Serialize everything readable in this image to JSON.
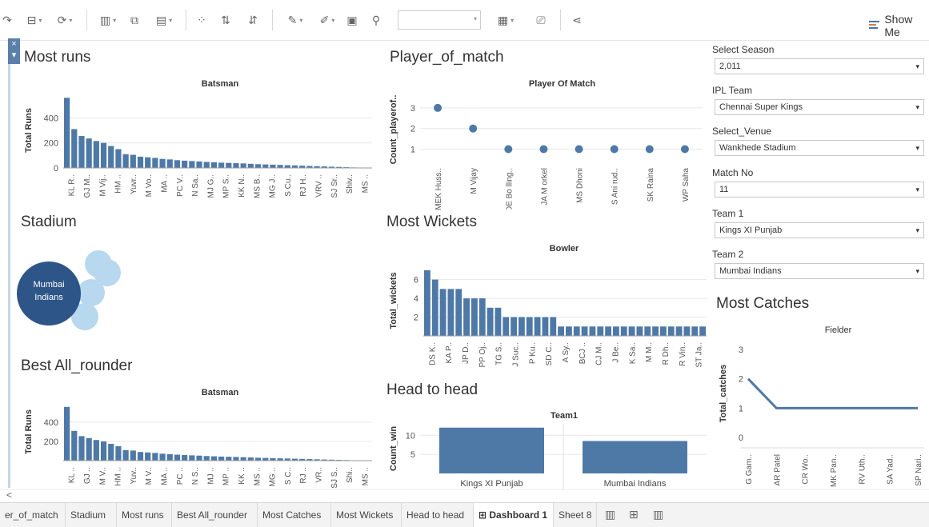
{
  "toolbar": {
    "show_me_label": "Show Me",
    "icons": [
      "redo-icon",
      "data-source-icon",
      "refresh-icon",
      "new-worksheet-icon",
      "duplicate-sheet-icon",
      "clear-sheet-icon",
      "group-icon",
      "sort-ascending-icon",
      "sort-descending-icon",
      "highlight-icon",
      "annotate-icon",
      "text-label-icon",
      "pin-icon",
      "fit-icon",
      "presentation-icon",
      "share-icon"
    ]
  },
  "dashboard": {
    "most_runs": {
      "title": "Most runs",
      "chart_data": {
        "type": "bar",
        "title": "Batsman",
        "ylabel": "Total Runs",
        "ylim": [
          0,
          600
        ],
        "yticks": [
          0,
          200,
          400
        ],
        "categories": [
          "KL R..",
          "GJ M..",
          "M Vij..",
          "HM ..",
          "Yuvr..",
          "M Vo..",
          "MA ..",
          "PC V..",
          "N Sa..",
          "MJ G..",
          "MP S..",
          "KK N..",
          "MS B..",
          "MG J..",
          "S Cu..",
          "RJ H..",
          "VRV ..",
          "SJ Sr..",
          "Shiv..",
          "MS .."
        ],
        "values": [
          560,
          310,
          255,
          235,
          215,
          200,
          175,
          150,
          110,
          105,
          90,
          85,
          80,
          72,
          68,
          62,
          58,
          55,
          52,
          48,
          45,
          42,
          40,
          38,
          36,
          33,
          30,
          28,
          26,
          24,
          22,
          20,
          18,
          16,
          14,
          12,
          10,
          8,
          6,
          4,
          3,
          2
        ]
      }
    },
    "player_of_match": {
      "title": "Player_of_match",
      "chart_data": {
        "type": "scatter",
        "title": "Player Of Match",
        "ylabel": "Count_playerof..",
        "ylim": [
          0.4,
          3.5
        ],
        "yticks": [
          1,
          2,
          3
        ],
        "categories": [
          "MEK Huss..",
          "M Vijay",
          "DE Bo lling..",
          "JA M orkel",
          "MS Dhoni",
          "S Ani rud..",
          "SK Raina",
          "WP Saha"
        ],
        "values": [
          3,
          2,
          1,
          1,
          1,
          1,
          1,
          1
        ]
      }
    },
    "stadium": {
      "title": "Stadium",
      "main_label": "Mumbai Indians",
      "main_color": "#2d5587",
      "other_color": "#b7d8ee"
    },
    "most_wickets": {
      "title": "Most Wickets",
      "chart_data": {
        "type": "bar",
        "title": "Bowler",
        "ylabel": "Total_wickets",
        "ylim": [
          0,
          7.5
        ],
        "yticks": [
          2,
          4,
          6
        ],
        "categories": [
          "DS K..",
          "KA P..",
          "JP D..",
          "PP Oj..",
          "TG S..",
          "J Suc..",
          "P Ku..",
          "SD C..",
          "A Sy..",
          "BCJ ..",
          "CJ M..",
          "J Be..",
          "K Sa..",
          "M M..",
          "R Dh..",
          "R Vin..",
          "ST Ja.."
        ],
        "values": [
          7,
          6,
          5,
          5,
          5,
          4,
          4,
          4,
          3,
          3,
          2,
          2,
          2,
          2,
          2,
          2,
          2,
          1,
          1,
          1,
          1,
          1,
          1,
          1,
          1,
          1,
          1,
          1,
          1,
          1,
          1,
          1,
          1,
          1,
          1,
          1
        ]
      }
    },
    "best_all_rounder": {
      "title": "Best All_rounder",
      "chart_data": {
        "type": "bar",
        "title": "Batsman",
        "ylabel": "Total Runs",
        "ylim": [
          0,
          600
        ],
        "yticks": [
          200,
          400
        ],
        "categories": [
          "KL ..",
          "GJ ..",
          "M V..",
          "HM ..",
          "Yuv..",
          "M V..",
          "MA ..",
          "PC ..",
          "N S..",
          "MJ ..",
          "MP ..",
          "KK ..",
          "MS ..",
          "MG ..",
          "S C..",
          "RJ ..",
          "VR..",
          "SJ S..",
          "Shi..",
          "MS .."
        ],
        "values": [
          560,
          310,
          255,
          235,
          215,
          200,
          175,
          150,
          110,
          105,
          90,
          85,
          80,
          72,
          68,
          62,
          58,
          55,
          52,
          48,
          45,
          42,
          40,
          38,
          36,
          33,
          30,
          28,
          26,
          24,
          22,
          20,
          18,
          16,
          14,
          12,
          10,
          8,
          6,
          4,
          3,
          2
        ]
      }
    },
    "head_to_head": {
      "title": "Head to head",
      "chart_data": {
        "type": "bar",
        "title": "Team1",
        "ylabel": "Count_win",
        "ylim": [
          0,
          13
        ],
        "yticks": [
          5,
          10
        ],
        "categories": [
          "Kings XI Punjab",
          "Mumbai Indians"
        ],
        "values": [
          12,
          8.5
        ]
      }
    },
    "most_catches": {
      "title": "Most Catches",
      "chart_data": {
        "type": "line",
        "title": "Fielder",
        "ylabel": "Total_catches",
        "ylim": [
          -0.3,
          3.3
        ],
        "yticks": [
          0,
          1,
          2,
          3
        ],
        "categories": [
          "G Gam..",
          "AR Patel",
          "CR Wo..",
          "MK Pan..",
          "RV Uth..",
          "SA Yad..",
          "SP Nari.."
        ],
        "values": [
          2,
          1,
          1,
          1,
          1,
          1,
          1
        ]
      }
    }
  },
  "filters": [
    {
      "label": "Select Season",
      "value": "2,011"
    },
    {
      "label": "IPL Team",
      "value": "Chennai Super Kings"
    },
    {
      "label": "Select_Venue",
      "value": "Wankhede Stadium"
    },
    {
      "label": "Match No",
      "value": "11"
    },
    {
      "label": "Team 1",
      "value": "Kings XI Punjab"
    },
    {
      "label": "Team 2",
      "value": "Mumbai Indians"
    }
  ],
  "scroll": {
    "left_arrow": "<"
  },
  "tabs": [
    {
      "label": "er_of_match",
      "active": false
    },
    {
      "label": "Stadium",
      "active": false
    },
    {
      "label": "Most runs",
      "active": false
    },
    {
      "label": "Best All_rounder",
      "active": false
    },
    {
      "label": "Most Catches",
      "active": false
    },
    {
      "label": "Most Wickets",
      "active": false
    },
    {
      "label": "Head to head",
      "active": false
    },
    {
      "label": "Dashboard 1",
      "active": true
    },
    {
      "label": "Sheet 8",
      "active": false
    }
  ],
  "close_glyph": "×",
  "dropdown_glyph": "▾",
  "colors": {
    "bar": "#4e79a7",
    "mark": "#4e79a7"
  }
}
